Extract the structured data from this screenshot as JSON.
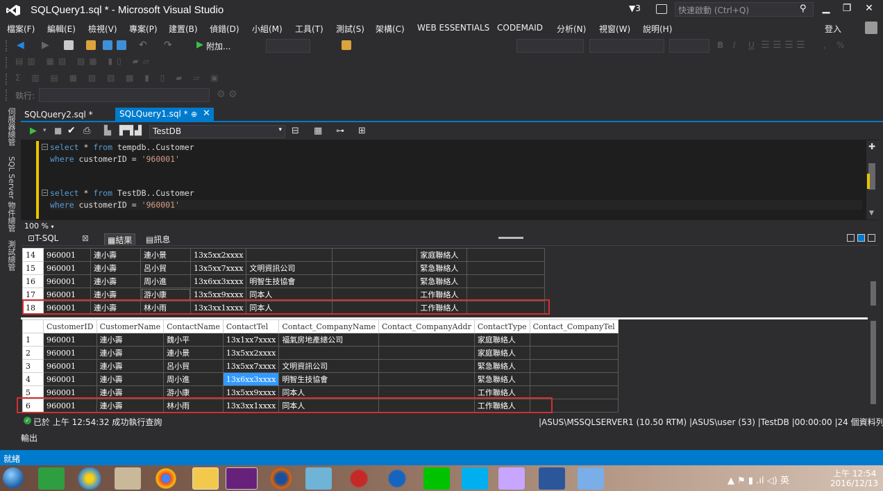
{
  "window": {
    "title": "SQLQuery1.sql * - Microsoft Visual Studio",
    "notifications": "3",
    "quick_launch_placeholder": "快速啟動 (Ctrl+Q)",
    "sign_in": "登入"
  },
  "menu": [
    "檔案(F)",
    "編輯(E)",
    "檢視(V)",
    "專案(P)",
    "建置(B)",
    "偵錯(D)",
    "小組(M)",
    "工具(T)",
    "測試(S)",
    "架構(C)",
    "WEB ESSENTIALS",
    "CODEMAID",
    "分析(N)",
    "視窗(W)",
    "說明(H)"
  ],
  "toolbar": {
    "attach_label": "附加...",
    "execute_label": "執行:"
  },
  "side_panels": [
    "伺服器總管",
    "SQL Server 物件總管",
    "測試總管"
  ],
  "doc_tabs": [
    {
      "label": "SQLQuery2.sql *"
    },
    {
      "label": "SQLQuery1.sql *"
    }
  ],
  "database": "TestDB",
  "editor": {
    "lines": [
      {
        "kw1": "select",
        "mid": " * ",
        "kw2": "from",
        "rest": " tempdb..Customer"
      },
      {
        "kw1": "where",
        "mid": " customerID = ",
        "str": "'960001'"
      },
      {
        "kw1": "select",
        "mid": " * ",
        "kw2": "from",
        "rest": " TestDB..Customer"
      },
      {
        "kw1": "where",
        "mid": " customerID = ",
        "str": "'960001'"
      }
    ],
    "zoom": "100 %"
  },
  "result_tabs": [
    "T-SQL",
    "結果",
    "訊息"
  ],
  "grid1": {
    "rows": [
      [
        "14",
        "960001",
        "連小壽",
        "連小景",
        "13x5xx2xxxx",
        "",
        "",
        "家庭聯絡人",
        ""
      ],
      [
        "15",
        "960001",
        "連小壽",
        "呂小貿",
        "13x5xx7xxxx",
        "文明資訊公司",
        "",
        "緊急聯絡人",
        ""
      ],
      [
        "16",
        "960001",
        "連小壽",
        "周小進",
        "13x6xx3xxxx",
        "明智生技協會",
        "",
        "緊急聯絡人",
        ""
      ],
      [
        "17",
        "960001",
        "連小壽",
        "游小康",
        "13x5xx9xxxx",
        "同本人",
        "",
        "工作聯絡人",
        ""
      ],
      [
        "18",
        "960001",
        "連小壽",
        "林小雨",
        "13x3xx1xxxx",
        "同本人",
        "",
        "工作聯絡人",
        ""
      ]
    ]
  },
  "grid2": {
    "columns": [
      "",
      "CustomerID",
      "CustomerName",
      "ContactName",
      "ContactTel",
      "Contact_CompanyName",
      "Contact_CompanyAddr",
      "ContactType",
      "Contact_CompanyTel"
    ],
    "rows": [
      [
        "1",
        "960001",
        "連小壽",
        "魏小平",
        "13x1xx7xxxx",
        "福氣房地產總公司",
        "",
        "家庭聯絡人",
        ""
      ],
      [
        "2",
        "960001",
        "連小壽",
        "連小景",
        "13x5xx2xxxx",
        "",
        "",
        "家庭聯絡人",
        ""
      ],
      [
        "3",
        "960001",
        "連小壽",
        "呂小貿",
        "13x5xx7xxxx",
        "文明資訊公司",
        "",
        "緊急聯絡人",
        ""
      ],
      [
        "4",
        "960001",
        "連小壽",
        "周小進",
        "13x6xx3xxxx",
        "明智生技協會",
        "",
        "緊急聯絡人",
        ""
      ],
      [
        "5",
        "960001",
        "連小壽",
        "游小康",
        "13x5xx9xxxx",
        "同本人",
        "",
        "工作聯絡人",
        ""
      ],
      [
        "6",
        "960001",
        "連小壽",
        "林小雨",
        "13x3xx1xxxx",
        "同本人",
        "",
        "工作聯絡人",
        ""
      ]
    ]
  },
  "exec_status": {
    "message": "已於 上午 12:54:32 成功執行查詢",
    "info": "|ASUS\\MSSQLSERVER1 (10.50 RTM) |ASUS\\user (53) |TestDB |00:00:00 |24 個資料列"
  },
  "output_label": "輸出",
  "statusbar": "就緒",
  "taskbar": {
    "tray": "▲  ⚑  ▮  .ıl  ◁)  英",
    "time": "上午 12:54",
    "date": "2016/12/13"
  },
  "colors": {
    "accent": "#007acc",
    "highlight": "#d32f2f",
    "selection": "#3399ff"
  }
}
